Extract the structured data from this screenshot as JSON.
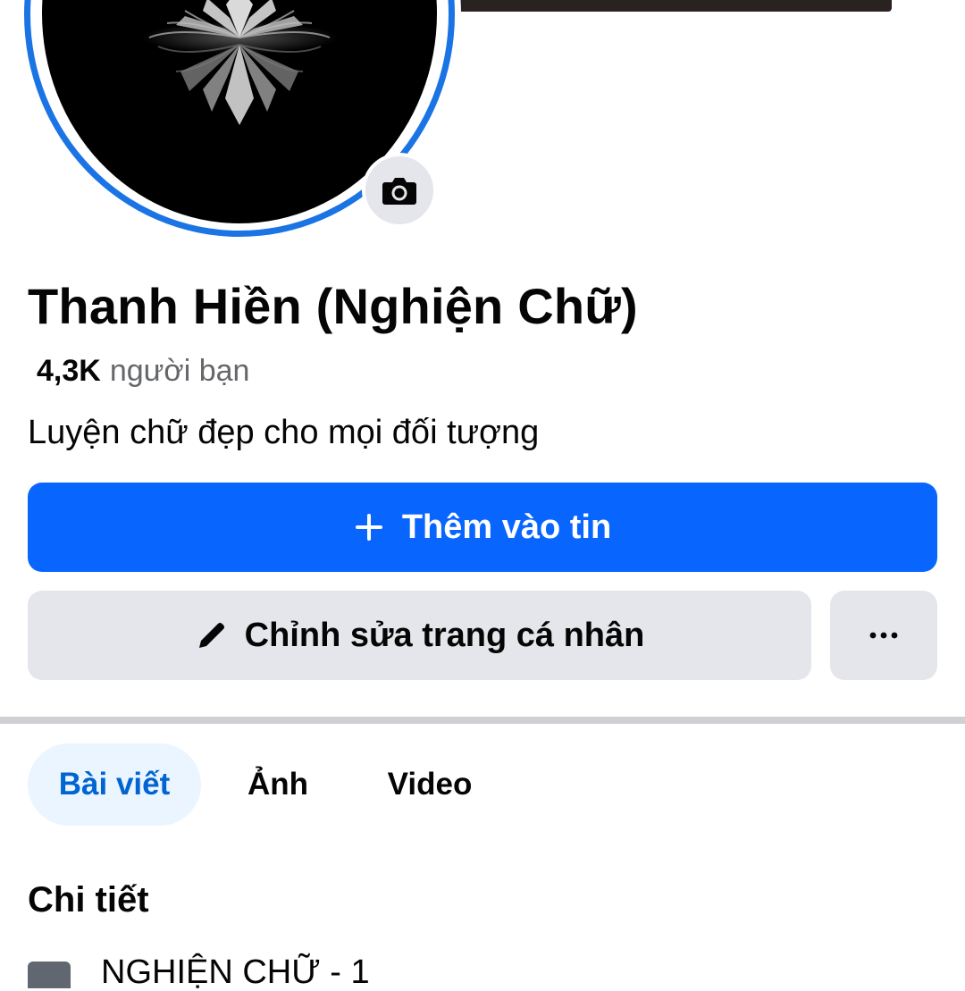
{
  "profile": {
    "name": "Thanh Hiền (Nghiện Chữ)",
    "friends_count": "4,3K",
    "friends_label": "người bạn",
    "bio": "Luyện chữ đẹp cho mọi đối tượng"
  },
  "actions": {
    "add_story_label": "Thêm vào tin",
    "edit_profile_label": "Chỉnh sửa trang cá nhân",
    "more_label": "···"
  },
  "tabs": [
    {
      "label": "Bài viết",
      "active": true
    },
    {
      "label": "Ảnh",
      "active": false
    },
    {
      "label": "Video",
      "active": false
    }
  ],
  "details": {
    "title": "Chi tiết",
    "items": [
      {
        "icon": "briefcase-icon",
        "text": "NGHIỆN CHỮ - 1"
      }
    ]
  },
  "icons": {
    "camera": "camera-icon",
    "plus": "plus-icon",
    "pencil": "pencil-icon",
    "more": "more-horizontal-icon"
  },
  "colors": {
    "primary": "#0866ff",
    "avatar_ring": "#1b74e4",
    "secondary_button": "#e4e6eb",
    "active_tab_bg": "#ebf5ff",
    "active_tab_text": "#0064d1",
    "muted_text": "#65676b"
  }
}
